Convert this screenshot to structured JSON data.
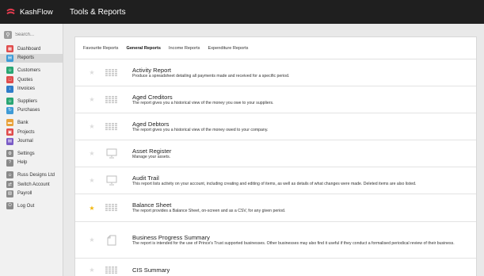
{
  "app": {
    "name": "KashFlow",
    "page_title": "Tools & Reports"
  },
  "colors": {
    "brand": "#e63b4f",
    "star_active": "#f2b70f",
    "topbar": "#1f1f1f"
  },
  "sidebar": {
    "search_placeholder": "Search...",
    "items": [
      {
        "label": "Dashboard",
        "icon": "dashboard-icon",
        "color": "#e04c4c",
        "active": false
      },
      {
        "label": "Reports",
        "icon": "reports-icon",
        "color": "#3f9bd6",
        "active": true
      },
      {
        "label": "Customers",
        "icon": "customers-icon",
        "color": "#2aa673",
        "active": false
      },
      {
        "label": "Quotes",
        "icon": "quotes-icon",
        "color": "#e04c4c",
        "active": false
      },
      {
        "label": "Invoices",
        "icon": "invoices-icon",
        "color": "#2f7dc9",
        "active": false
      },
      {
        "label": "Suppliers",
        "icon": "suppliers-icon",
        "color": "#2aa673",
        "active": false
      },
      {
        "label": "Purchases",
        "icon": "purchases-icon",
        "color": "#3f9bd6",
        "active": false
      },
      {
        "label": "Bank",
        "icon": "bank-icon",
        "color": "#e8a13a",
        "active": false
      },
      {
        "label": "Projects",
        "icon": "projects-icon",
        "color": "#e04c4c",
        "active": false
      },
      {
        "label": "Journal",
        "icon": "journal-icon",
        "color": "#7a5bc6",
        "active": false
      },
      {
        "label": "Settings",
        "icon": "gear-icon",
        "color": "#8a8a8a",
        "active": false
      },
      {
        "label": "Help",
        "icon": "help-icon",
        "color": "#8a8a8a",
        "active": false
      },
      {
        "label": "Russ Designs Ltd",
        "icon": "user-icon",
        "color": "#8a8a8a",
        "active": false
      },
      {
        "label": "Switch Account",
        "icon": "switch-icon",
        "color": "#8a8a8a",
        "active": false
      },
      {
        "label": "Payroll",
        "icon": "payroll-icon",
        "color": "#8a8a8a",
        "active": false
      },
      {
        "label": "Log Out",
        "icon": "logout-icon",
        "color": "#8a8a8a",
        "active": false
      }
    ]
  },
  "tabs": [
    {
      "label": "Favourite Reports",
      "active": false
    },
    {
      "label": "General Reports",
      "active": true
    },
    {
      "label": "Income Reports",
      "active": false
    },
    {
      "label": "Expenditure Reports",
      "active": false
    }
  ],
  "reports": [
    {
      "title": "Activity Report",
      "description": "Produce a spreadsheet detailing all payments made and received for a specific period.",
      "icon": "spreadsheet-icon",
      "favourite": false
    },
    {
      "title": "Aged Creditors",
      "description": "The report gives you a historical view of the money you owe to your suppliers.",
      "icon": "spreadsheet-icon",
      "favourite": false
    },
    {
      "title": "Aged Debtors",
      "description": "The report gives you a historical view of the money owed to your company.",
      "icon": "spreadsheet-icon",
      "favourite": false
    },
    {
      "title": "Asset Register",
      "description": "Manage your assets.",
      "icon": "monitor-icon",
      "favourite": false
    },
    {
      "title": "Audit Trail",
      "description": "This report lists activity on your account, including creating and editing of items, as well as details of what changes were made. Deleted items are also listed.",
      "icon": "monitor-icon",
      "favourite": false
    },
    {
      "title": "Balance Sheet",
      "description": "The report provides a Balance Sheet, on-screen and as a CSV, for any given period.",
      "icon": "spreadsheet-icon",
      "favourite": true
    },
    {
      "title": "Business Progress Summary",
      "description": "The report is intended for the use of Prince's Trust supported businesses. Other businesses may also find it useful if they conduct a formalised periodical review of their business.",
      "icon": "document-icon",
      "favourite": false
    },
    {
      "title": "CIS Summary",
      "description": "",
      "icon": "spreadsheet-icon",
      "favourite": false
    }
  ]
}
